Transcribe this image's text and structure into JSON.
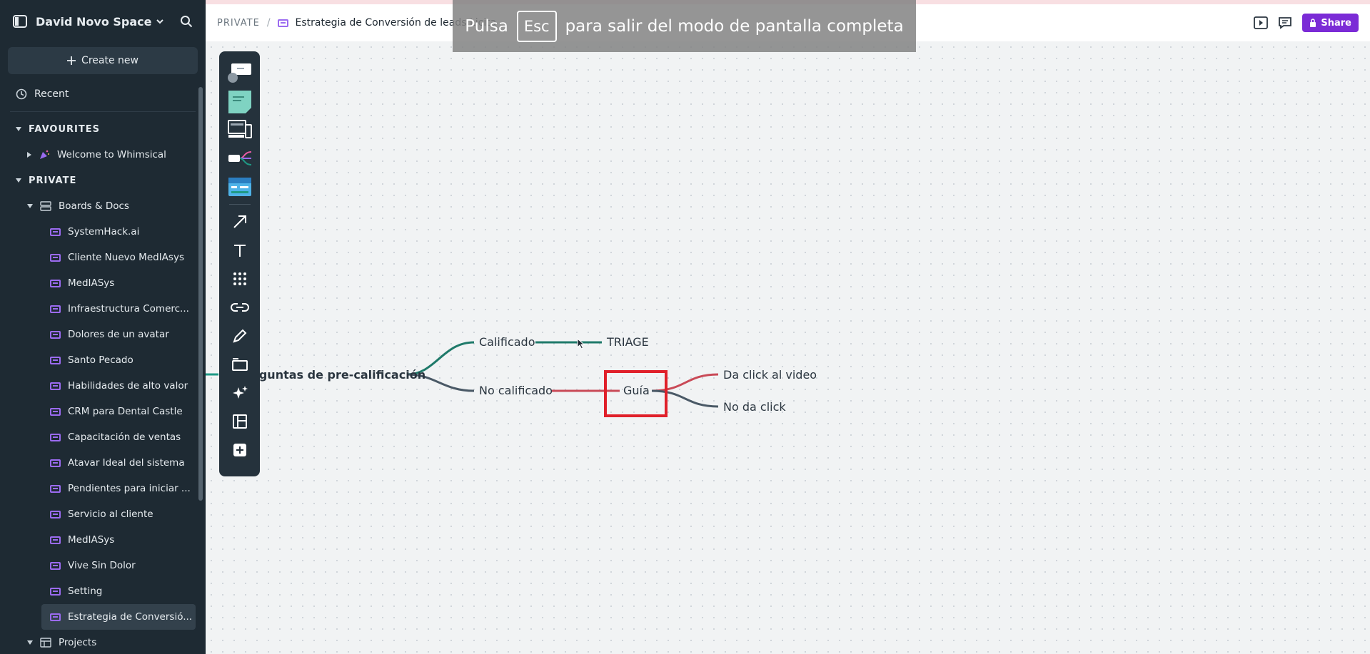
{
  "sidebar": {
    "workspace": "David Novo Space",
    "create_new": "Create new",
    "recent": "Recent",
    "favourites_label": "FAVOURITES",
    "favourites": [
      {
        "label": "Welcome to Whimsical"
      }
    ],
    "private_label": "PRIVATE",
    "boards_folder": "Boards & Docs",
    "boards": [
      {
        "label": "SystemHack.ai"
      },
      {
        "label": "Cliente Nuevo MedIAsys"
      },
      {
        "label": "MedIASys"
      },
      {
        "label": "Infraestructura Comerc..."
      },
      {
        "label": "Dolores de un avatar"
      },
      {
        "label": "Santo Pecado"
      },
      {
        "label": "Habilidades de alto valor"
      },
      {
        "label": "CRM para Dental Castle"
      },
      {
        "label": "Capacitación de ventas"
      },
      {
        "label": "Atavar Ideal del sistema"
      },
      {
        "label": "Pendientes para iniciar ..."
      },
      {
        "label": "Servicio al cliente"
      },
      {
        "label": "MedIASys"
      },
      {
        "label": "Vive Sin Dolor"
      },
      {
        "label": "Setting"
      },
      {
        "label": "Estrategia de Conversió..."
      }
    ],
    "projects_folder": "Projects"
  },
  "topbar": {
    "section": "PRIVATE",
    "separator": "/",
    "board_title": "Estrategia de Conversión de leads Licita",
    "share": "Share"
  },
  "overlay": {
    "pre": "Pulsa",
    "key": "Esc",
    "post": "para salir del modo de pantalla completa"
  },
  "mindmap": {
    "root": "eguntas de pre-calificación",
    "calificado": "Calificado",
    "triage": "TRIAGE",
    "no_calificado": "No calificado",
    "guia": "Guía",
    "da_click": "Da click al video",
    "no_da_click": "No da click"
  },
  "colors": {
    "accent": "#7b2bd6",
    "green_branch": "#1f7a6a",
    "gray_branch": "#4a5966",
    "red_branch": "#c94a57",
    "highlight": "#e0202a"
  }
}
